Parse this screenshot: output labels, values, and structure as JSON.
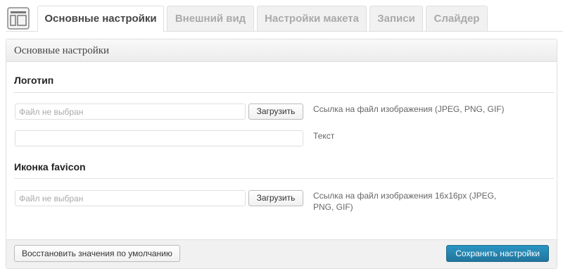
{
  "tabs": [
    {
      "label": "Основные настройки",
      "active": true
    },
    {
      "label": "Внешний вид",
      "active": false
    },
    {
      "label": "Настройки макета",
      "active": false
    },
    {
      "label": "Записи",
      "active": false
    },
    {
      "label": "Слайдер",
      "active": false
    }
  ],
  "panel": {
    "title": "Основные настройки",
    "logo": {
      "title": "Логотип",
      "file_placeholder": "Файл не выбран",
      "upload_label": "Загрузить",
      "file_hint": "Ссылка на файл изображения (JPEG, PNG, GIF)",
      "text_value": "",
      "text_hint": "Текст"
    },
    "favicon": {
      "title": "Иконка favicon",
      "file_placeholder": "Файл не выбран",
      "upload_label": "Загрузить",
      "file_hint": "Ссылка на файл изображения 16x16px (JPEG, PNG, GIF)"
    },
    "footer": {
      "reset_label": "Восстановить значения по умолчанию",
      "save_label": "Сохранить настройки"
    }
  },
  "icons": {
    "page_icon": "layout-icon"
  },
  "colors": {
    "accent": "#21759b",
    "border": "#dfdfdf"
  }
}
